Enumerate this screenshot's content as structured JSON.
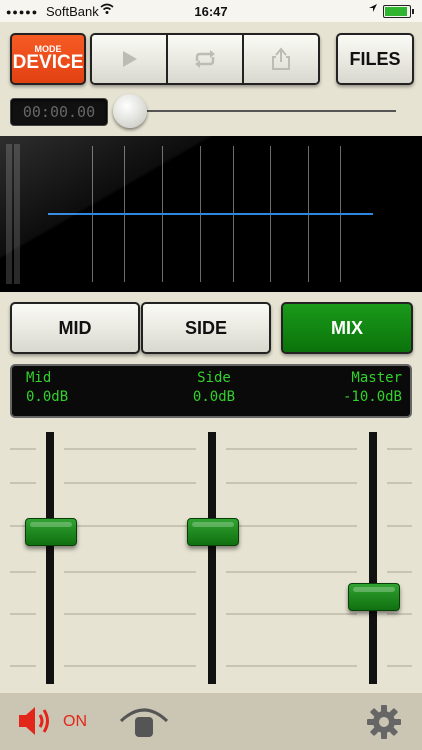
{
  "status_bar": {
    "carrier": "SoftBank",
    "time": "16:47",
    "signal_dots": "●●●●●"
  },
  "toolbar": {
    "mode_label": "MODE",
    "mode_value": "DEVICE",
    "play_icon": "play-icon",
    "repeat_icon": "repeat-icon",
    "share_icon": "share-icon",
    "files_label": "FILES"
  },
  "transport": {
    "time": "00:00.00",
    "seek_position": 0.0
  },
  "segments": {
    "mid": "MID",
    "side": "SIDE",
    "mix": "MIX",
    "selected": "MIX"
  },
  "levels": {
    "mid_label": "Mid",
    "mid_value": "0.0dB",
    "side_label": "Side",
    "side_value": "0.0dB",
    "master_label": "Master",
    "master_value": "-10.0dB"
  },
  "faders": [
    {
      "name": "mid",
      "level": 0.62
    },
    {
      "name": "side",
      "level": 0.62
    },
    {
      "name": "master",
      "level": 0.33
    }
  ],
  "bottom_bar": {
    "speaker_state": "ON",
    "speaker_icon": "speaker-icon",
    "mic_icon": "headset-mic-icon",
    "settings_icon": "gear-icon"
  },
  "colors": {
    "accent_orange": "#f04e1d",
    "accent_green": "#0f7e0f",
    "lcd_green": "#33d12b",
    "scope_line": "#2e86e0",
    "on_red": "#e2261a"
  }
}
